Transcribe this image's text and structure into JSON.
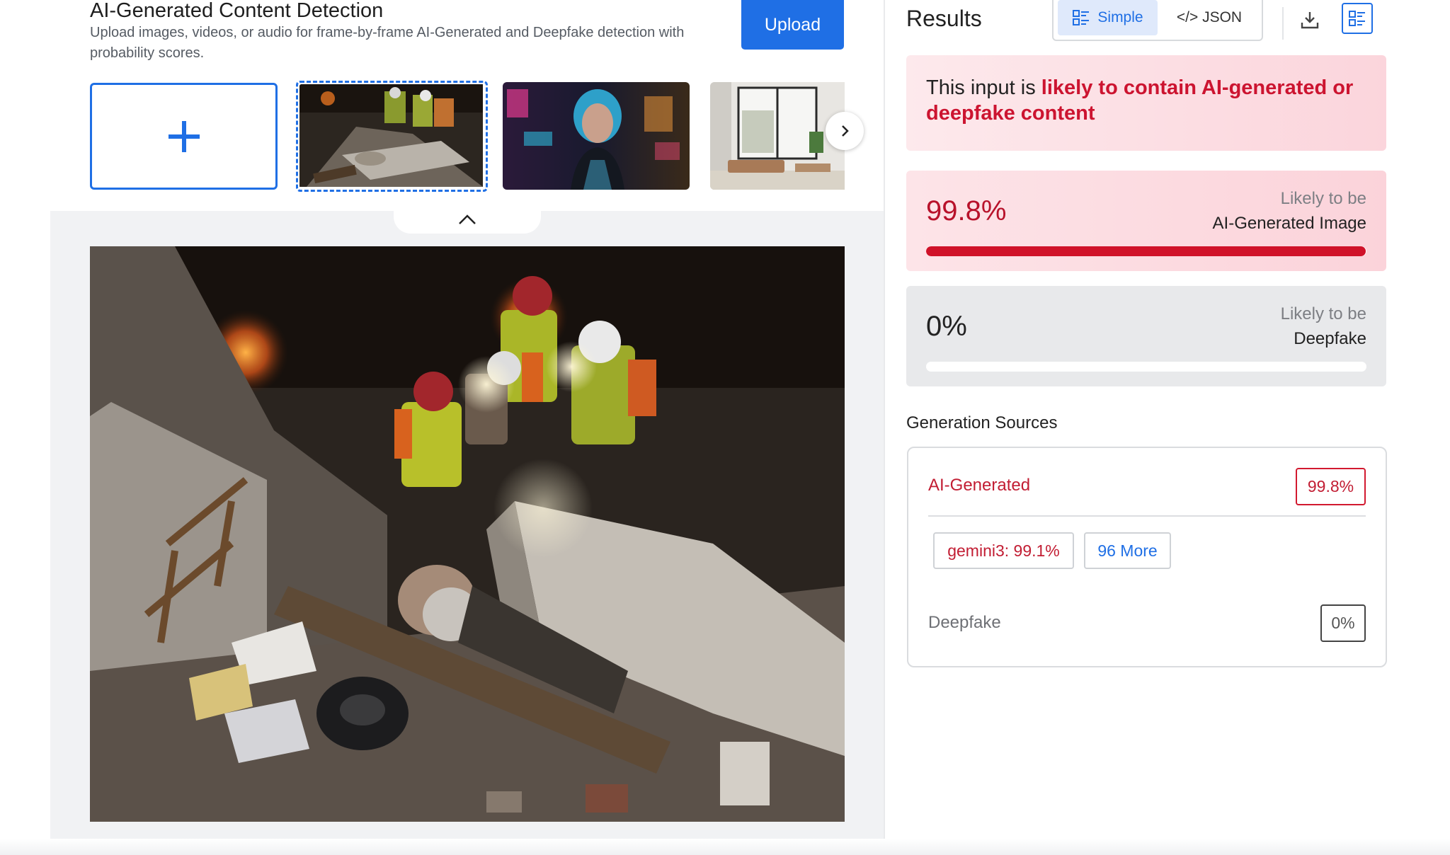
{
  "header": {
    "title": "AI-Generated Content Detection",
    "subtitle": "Upload images, videos, or audio for frame-by-frame AI-Generated and Deepfake detection with probability scores.",
    "upload_label": "Upload"
  },
  "gallery": {
    "thumbnails": [
      "rescue-workers-rubble",
      "cyberpunk-woman-neon",
      "modern-interior"
    ],
    "selected_index": 0
  },
  "results": {
    "title": "Results",
    "view_simple": "Simple",
    "view_json": "</> JSON",
    "verdict_prefix": "This input is ",
    "verdict_highlight": "likely to contain AI-generated or deepfake content",
    "ai_card": {
      "percent": "99.8%",
      "line1": "Likely to be",
      "line2": "AI-Generated Image",
      "fill": 0.998
    },
    "deepfake_card": {
      "percent": "0%",
      "line1": "Likely to be",
      "line2": "Deepfake",
      "fill": 0
    },
    "generation_sources": {
      "title": "Generation Sources",
      "ai_label": "AI-Generated",
      "ai_value": "99.8%",
      "chips": {
        "gemini": "gemini3: 99.1%",
        "more": "96 More"
      },
      "deepfake_label": "Deepfake",
      "deepfake_value": "0%"
    }
  },
  "colors": {
    "accent": "#1f6fe5",
    "danger": "#c21d33",
    "danger_bar": "#d01229"
  }
}
